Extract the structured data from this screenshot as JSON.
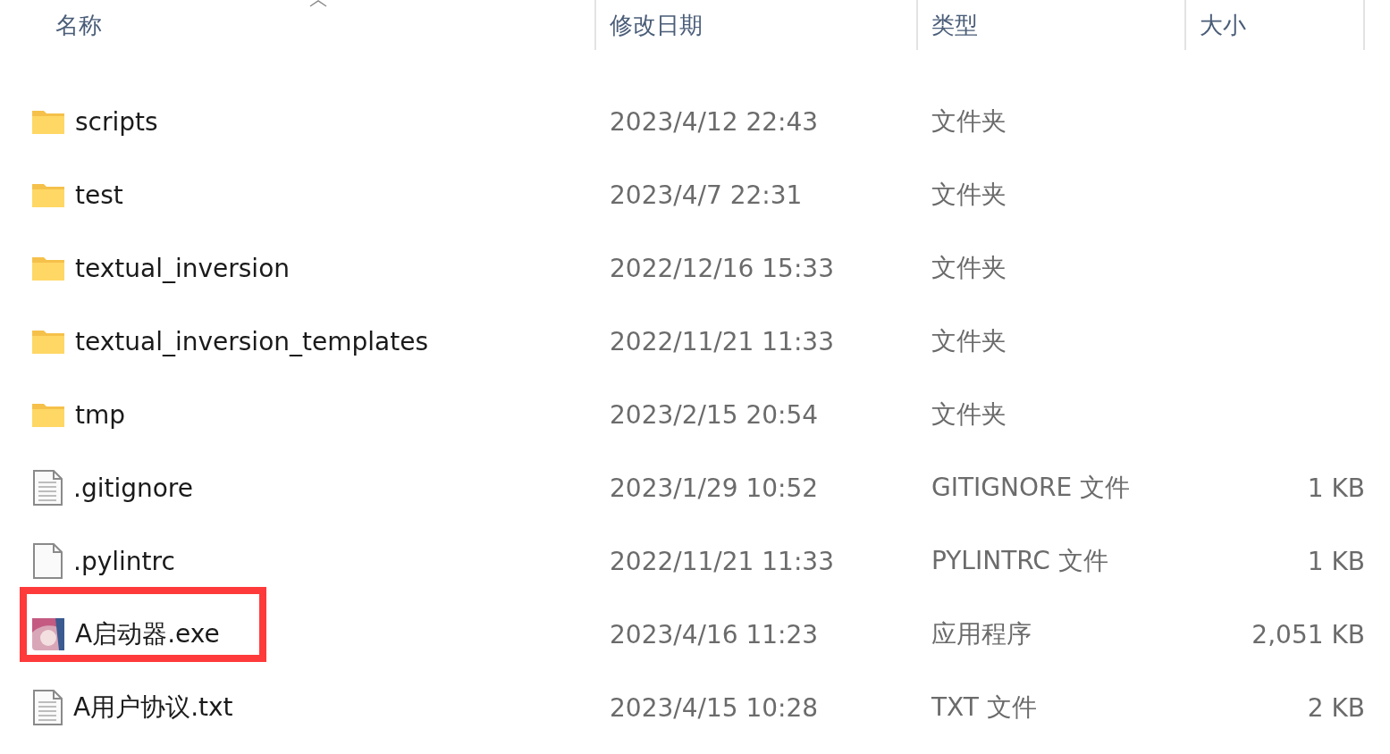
{
  "columns": [
    {
      "label": "名称",
      "sorted": true
    },
    {
      "label": "修改日期",
      "sorted": false
    },
    {
      "label": "类型",
      "sorted": false
    },
    {
      "label": "大小",
      "sorted": false
    }
  ],
  "rows": [
    {
      "kind": "folder",
      "name": "scripts",
      "date": "2023/4/12 22:43",
      "type": "文件夹",
      "highlighted": false
    },
    {
      "kind": "folder",
      "name": "test",
      "date": "2023/4/7 22:31",
      "type": "文件夹",
      "highlighted": false
    },
    {
      "kind": "folder",
      "name": "textual_inversion",
      "date": "2022/12/16 15:33",
      "type": "文件夹",
      "highlighted": false
    },
    {
      "kind": "folder",
      "name": "textual_inversion_templates",
      "date": "2022/11/21 11:33",
      "type": "文件夹",
      "highlighted": false
    },
    {
      "kind": "folder",
      "name": "tmp",
      "date": "2023/2/15 20:54",
      "type": "文件夹",
      "highlighted": false
    },
    {
      "kind": "text",
      "name": ".gitignore",
      "date": "2023/1/29 10:52",
      "type": "GITIGNORE 文件",
      "size": "1 KB",
      "highlighted": false
    },
    {
      "kind": "blank",
      "name": ".pylintrc",
      "date": "2022/11/21 11:33",
      "type": "PYLINTRC 文件",
      "size": "1 KB",
      "highlighted": false
    },
    {
      "kind": "app",
      "name": "A启动器.exe",
      "date": "2023/4/16 11:23",
      "type": "应用程序",
      "size": "2,051 KB",
      "highlighted": true
    },
    {
      "kind": "text",
      "name": "A用户协议.txt",
      "date": "2023/4/15 10:28",
      "type": "TXT 文件",
      "size": "2 KB",
      "highlighted": false
    }
  ]
}
